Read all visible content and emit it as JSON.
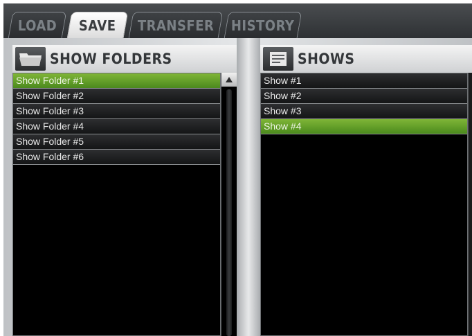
{
  "tabs": [
    {
      "label": "LOAD",
      "state": "inactive"
    },
    {
      "label": "SAVE",
      "state": "active"
    },
    {
      "label": "TRANSFER",
      "state": "inactive"
    },
    {
      "label": "HISTORY",
      "state": "inactive"
    }
  ],
  "folders_panel": {
    "title": "SHOW FOLDERS",
    "icon": "folder-icon",
    "items": [
      "Show Folder #1",
      "Show Folder #2",
      "Show Folder #3",
      "Show Folder #4",
      "Show Folder #5",
      "Show Folder #6"
    ],
    "selected": "Show Folder #1"
  },
  "shows_panel": {
    "title": "SHOWS",
    "icon": "document-icon",
    "items": [
      "Show #1",
      "Show #2",
      "Show #3",
      "Show #4"
    ],
    "selected": "Show #4"
  },
  "colors": {
    "selected_green": "#6aa72c",
    "tab_bar": "#3a3d40",
    "list_background": "#000000"
  }
}
